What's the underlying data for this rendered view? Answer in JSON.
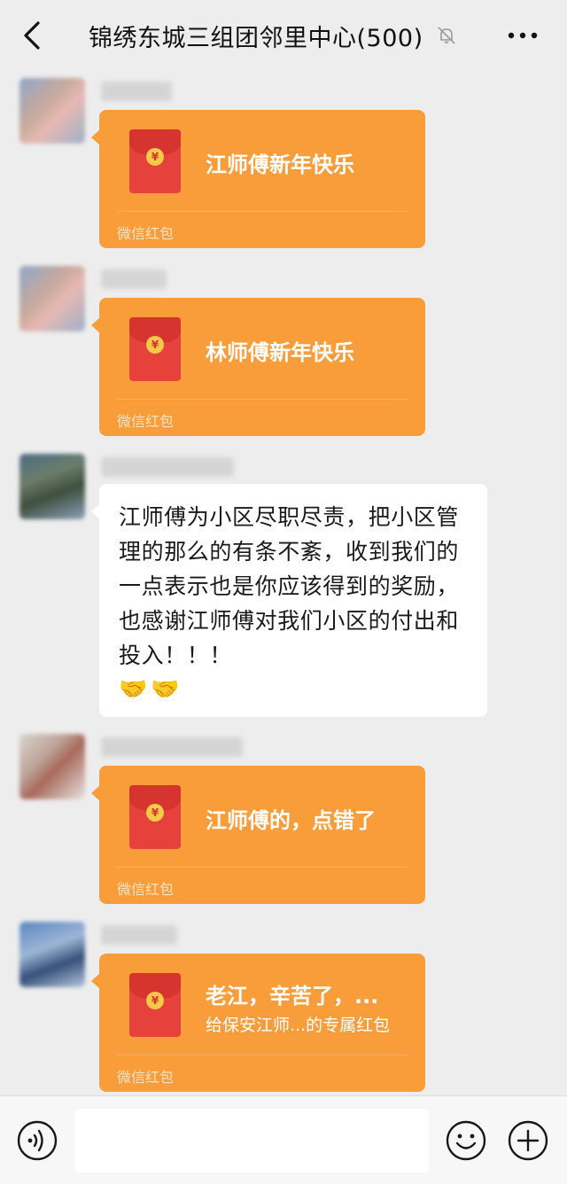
{
  "header": {
    "title": "锦绣东城三组团邻里中心(500)"
  },
  "messages": [
    {
      "type": "red_packet",
      "title": "江师傅新年快乐",
      "footer": "微信红包"
    },
    {
      "type": "red_packet",
      "title": "林师傅新年快乐",
      "footer": "微信红包"
    },
    {
      "type": "text",
      "text": "江师傅为小区尽职尽责，把小区管理的那么的有条不紊，收到我们的一点表示也是你应该得到的奖励，也感谢江师傅对我们小区的付出和投入！！！",
      "emojis": [
        "🤝",
        "🤝"
      ]
    },
    {
      "type": "red_packet",
      "title": "江师傅的，点错了",
      "footer": "微信红包"
    },
    {
      "type": "red_packet",
      "title": "老江，辛苦了，...",
      "subtitle": "给保安江师...的专属红包",
      "footer": "微信红包"
    }
  ],
  "colors": {
    "background": "#ededed",
    "packet": "#f89d3a",
    "envelope": "#e6413b"
  },
  "icons": {
    "back": "chevron-left-icon",
    "mute": "bell-off-icon",
    "more": "more-dots-icon",
    "voice": "voice-icon",
    "emoji": "smiley-icon",
    "plus": "plus-circle-icon"
  }
}
